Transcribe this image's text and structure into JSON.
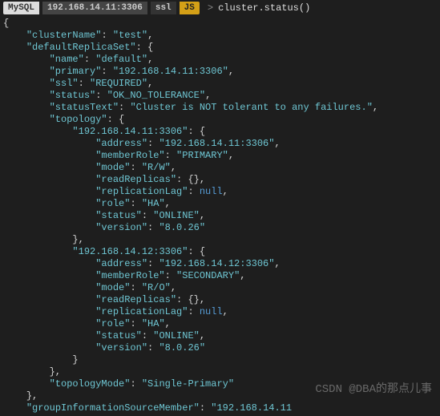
{
  "prompt": {
    "mysql": "MySQL",
    "host": "192.168.14.11:3306",
    "ssl": "ssl",
    "lang": "JS",
    "arrow": ">",
    "command": "cluster.status()"
  },
  "result": {
    "clusterName": "test",
    "defaultReplicaSet": {
      "name": "default",
      "primary": "192.168.14.11:3306",
      "ssl": "REQUIRED",
      "status": "OK_NO_TOLERANCE",
      "statusText": "Cluster is NOT tolerant to any failures.",
      "topology": {
        "192.168.14.11:3306": {
          "address": "192.168.14.11:3306",
          "memberRole": "PRIMARY",
          "mode": "R/W",
          "readReplicas": "{}",
          "replicationLag": "null",
          "role": "HA",
          "status": "ONLINE",
          "version": "8.0.26"
        },
        "192.168.14.12:3306": {
          "address": "192.168.14.12:3306",
          "memberRole": "SECONDARY",
          "mode": "R/O",
          "readReplicas": "{}",
          "replicationLag": "null",
          "role": "HA",
          "status": "ONLINE",
          "version": "8.0.26"
        }
      },
      "topologyMode": "Single-Primary"
    },
    "groupInformationSourceMember_key": "groupInformationSourceMember",
    "groupInformationSourceMember_val": "192.168.14.11"
  },
  "watermark": "CSDN @DBA的那点儿事"
}
